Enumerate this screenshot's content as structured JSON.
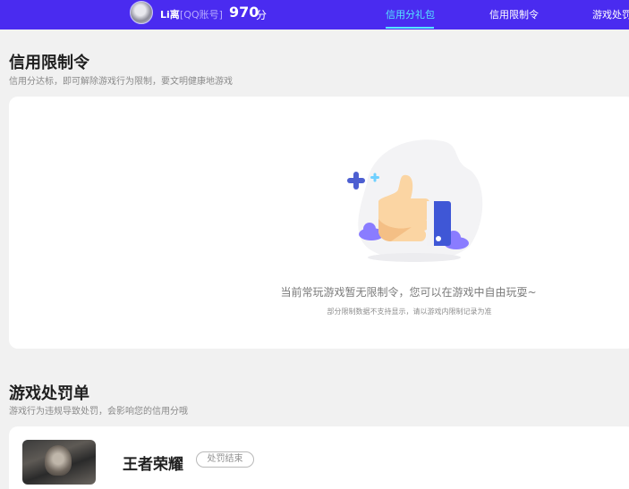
{
  "header": {
    "username": "Li离",
    "account_type": "[QQ账号]",
    "score": "970",
    "score_unit": "分",
    "tabs": [
      {
        "label": "信用分礼包",
        "active": true
      },
      {
        "label": "信用限制令",
        "active": false
      },
      {
        "label": "游戏处罚",
        "active": false
      }
    ],
    "accent_color": "#4a2bf0",
    "active_tab_color": "#55e6ff"
  },
  "restriction": {
    "title": "信用限制令",
    "subtitle": "信用分达标，即可解除游戏行为限制，要文明健康地游戏",
    "empty_message": "当前常玩游戏暂无限制令，您可以在游戏中自由玩耍~",
    "empty_note": "部分限制数据不支持显示，请以游戏内限制记录为准",
    "illustration_icon": "thumbs-up-icon"
  },
  "penalty": {
    "title": "游戏处罚单",
    "subtitle": "游戏行为违规导致处罚，会影响您的信用分哦",
    "items": [
      {
        "game": "王者荣耀",
        "status": "处罚结束"
      }
    ]
  }
}
